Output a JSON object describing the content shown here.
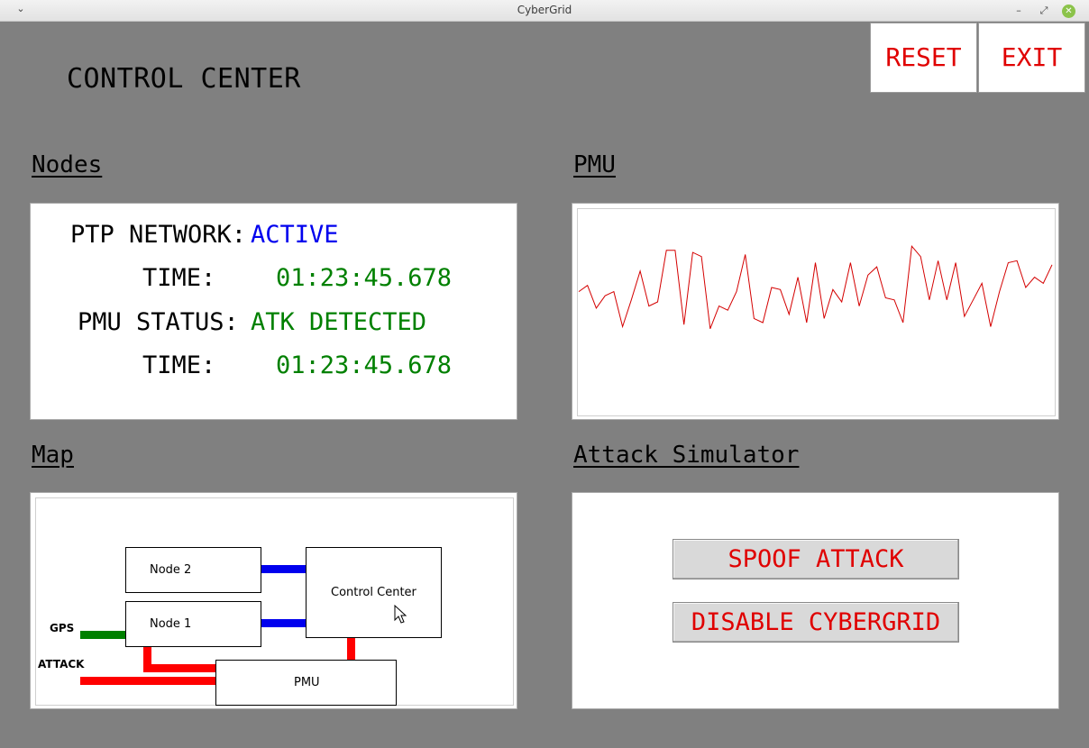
{
  "window": {
    "title": "CyberGrid",
    "menu_glyph": "⌄",
    "min_glyph": "–",
    "max_glyph": "⤢",
    "close_glyph": "✕"
  },
  "header": {
    "title": "CONTROL CENTER",
    "reset_label": "RESET",
    "exit_label": "EXIT"
  },
  "nodes": {
    "heading": "Nodes",
    "ptp_label": "PTP NETWORK:",
    "ptp_value": "ACTIVE",
    "ptp_time_label": "TIME:",
    "ptp_time_value": "01:23:45.678",
    "pmu_label": "PMU STATUS:",
    "pmu_value": "ATK DETECTED",
    "pmu_time_label": "TIME:",
    "pmu_time_value": "01:23:45.678",
    "colors": {
      "active": "#0000ee",
      "ok": "#008000"
    }
  },
  "pmu": {
    "heading": "PMU",
    "line_color": "#d40000",
    "chart_data": {
      "type": "line",
      "x": [
        0,
        1,
        2,
        3,
        4,
        5,
        6,
        7,
        8,
        9,
        10,
        11,
        12,
        13,
        14,
        15,
        16,
        17,
        18,
        19,
        20,
        21,
        22,
        23,
        24,
        25,
        26,
        27,
        28,
        29,
        30,
        31,
        32,
        33,
        34,
        35,
        36,
        37,
        38,
        39,
        40,
        41,
        42,
        43,
        44,
        45,
        46,
        47,
        48,
        49,
        50,
        51,
        52,
        53,
        54
      ],
      "y": [
        0.6,
        0.63,
        0.52,
        0.58,
        0.6,
        0.43,
        0.56,
        0.7,
        0.53,
        0.55,
        0.8,
        0.8,
        0.44,
        0.79,
        0.77,
        0.42,
        0.53,
        0.51,
        0.6,
        0.78,
        0.47,
        0.45,
        0.62,
        0.61,
        0.49,
        0.67,
        0.45,
        0.74,
        0.47,
        0.61,
        0.55,
        0.74,
        0.53,
        0.68,
        0.72,
        0.57,
        0.56,
        0.45,
        0.82,
        0.77,
        0.56,
        0.75,
        0.56,
        0.74,
        0.48,
        0.56,
        0.64,
        0.43,
        0.6,
        0.74,
        0.75,
        0.62,
        0.67,
        0.64,
        0.73
      ]
    }
  },
  "map": {
    "heading": "Map",
    "node2": "Node 2",
    "node1": "Node 1",
    "control_center": "Control Center",
    "pmu": "PMU",
    "gps": "GPS",
    "attack": "ATTACK",
    "colors": {
      "network": "#0000ee",
      "gps": "#008000",
      "attack": "#ff0000"
    }
  },
  "attack": {
    "heading": "Attack Simulator",
    "spoof_label": "SPOOF ATTACK",
    "disable_label": "DISABLE CYBERGRID"
  }
}
